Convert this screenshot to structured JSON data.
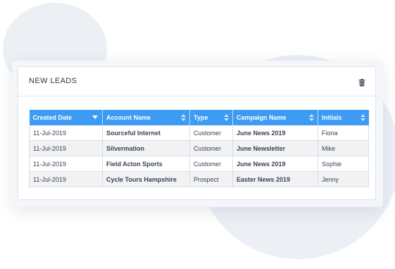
{
  "panel": {
    "title": "NEW LEADS",
    "action_icon": "trash-icon"
  },
  "table": {
    "columns": [
      {
        "label": "Created Date",
        "sort": "descending"
      },
      {
        "label": "Account Name",
        "sort": "none"
      },
      {
        "label": "Type",
        "sort": "none"
      },
      {
        "label": "Campaign Name",
        "sort": "none"
      },
      {
        "label": "Initials",
        "sort": "none"
      }
    ],
    "rows": [
      {
        "created_date": "11-Jul-2019",
        "account_name": "Sourceful Internet",
        "type": "Customer",
        "campaign_name": "June News 2019",
        "initials": "Fiona"
      },
      {
        "created_date": "11-Jul-2019",
        "account_name": "Silvermation",
        "type": "Customer",
        "campaign_name": "June Newsletter",
        "initials": "Mike"
      },
      {
        "created_date": "11-Jul-2019",
        "account_name": "Field Acton Sports",
        "type": "Customer",
        "campaign_name": "June News 2019",
        "initials": "Sophie"
      },
      {
        "created_date": "11-Jul-2019",
        "account_name": "Cycle Tours Hampshire",
        "type": "Prospect",
        "campaign_name": "Easter News 2019",
        "initials": "Jenny"
      }
    ]
  },
  "colors": {
    "header_bg": "#3d9bf4",
    "accent": "#3d9bf4",
    "row_alt": "#f1f2f4"
  }
}
